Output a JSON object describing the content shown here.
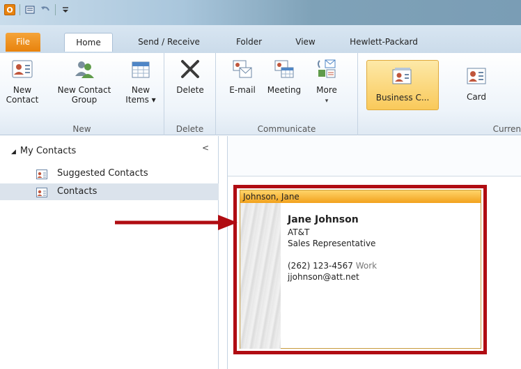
{
  "quick_access": {
    "app_letter": "O"
  },
  "tabs": [
    {
      "label": "File"
    },
    {
      "label": "Home"
    },
    {
      "label": "Send / Receive"
    },
    {
      "label": "Folder"
    },
    {
      "label": "View"
    },
    {
      "label": "Hewlett-Packard"
    }
  ],
  "ribbon": {
    "new_group": {
      "label": "New",
      "new_contact": "New\nContact",
      "new_contact_group": "New Contact\nGroup",
      "new_items": "New\nItems ▾"
    },
    "delete_group": {
      "label": "Delete",
      "delete": "Delete"
    },
    "communicate_group": {
      "label": "Communicate",
      "email": "E-mail",
      "meeting": "Meeting",
      "more": "More"
    },
    "current_view_group": {
      "label": "Curren",
      "business_card": "Business C...",
      "card": "Card"
    }
  },
  "navigation": {
    "section": "My Contacts",
    "items": [
      {
        "label": "Suggested Contacts"
      },
      {
        "label": "Contacts"
      }
    ]
  },
  "card": {
    "header": "Johnson, Jane",
    "name": "Jane Johnson",
    "company": "AT&T",
    "title": "Sales Representative",
    "phone": "(262) 123-4567",
    "phone_label": "Work",
    "email": "jjohnson@att.net"
  },
  "colors": {
    "highlight_border": "#b00c12",
    "card_header": "#f2a21d",
    "file_tab": "#e8820c"
  }
}
